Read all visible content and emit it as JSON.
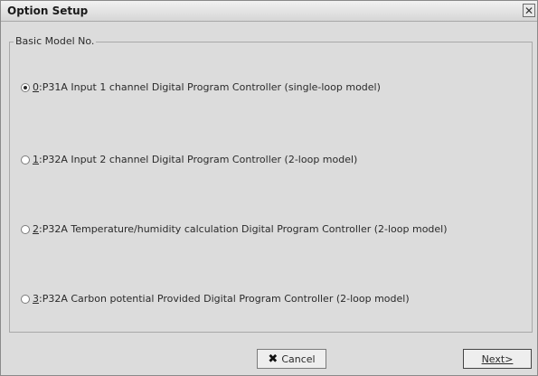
{
  "window": {
    "title": "Option Setup",
    "close_glyph": "✕"
  },
  "group": {
    "title": "Basic Model No."
  },
  "options": [
    {
      "key": "0",
      "label": ":P31A Input 1 channel Digital Program Controller (single-loop model)",
      "selected": true
    },
    {
      "key": "1",
      "label": ":P32A Input 2 channel Digital Program Controller (2-loop model)",
      "selected": false
    },
    {
      "key": "2",
      "label": ":P32A Temperature/humidity calculation Digital Program Controller (2-loop model)",
      "selected": false
    },
    {
      "key": "3",
      "label": ":P32A Carbon potential Provided Digital Program Controller (2-loop model)",
      "selected": false
    }
  ],
  "buttons": {
    "cancel_label": "Cancel",
    "cancel_icon": "x-icon",
    "next_label": "Next>"
  }
}
